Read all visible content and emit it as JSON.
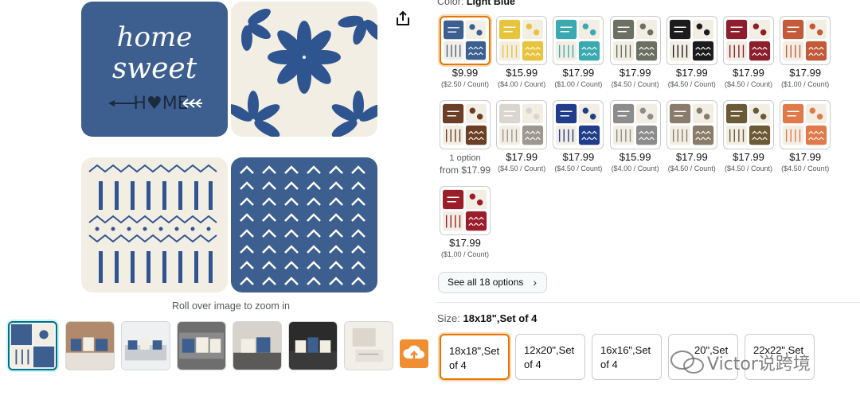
{
  "main_image": {
    "pillow1_text": [
      "home",
      "sweet",
      "H♥ME"
    ],
    "zoom_hint": "Roll over image to zoom in"
  },
  "icons": {
    "share": "share-icon",
    "upload": "upload-icon",
    "chevron": "chevron-right-icon"
  },
  "colors": {
    "navy": "#3d5f8f",
    "cream": "#f3eee4",
    "selected_border": "#e77600",
    "link_teal": "#007185"
  },
  "color_section": {
    "label": "Color:",
    "selected_value": "Light Blue"
  },
  "swatches": [
    {
      "price": "$9.99",
      "unit": "($2.50 / Count)",
      "c1": "#3d5f8f",
      "c2": "#3d5f8f",
      "selected": true
    },
    {
      "price": "$15.99",
      "unit": "($4.00 / Count)",
      "c1": "#e8c43c",
      "c2": "#e8c43c"
    },
    {
      "price": "$17.99",
      "unit": "($1.00 / Count)",
      "c1": "#3aaab0",
      "c2": "#3aaab0"
    },
    {
      "price": "$17.99",
      "unit": "($4.50 / Count)",
      "c1": "#6b7062",
      "c2": "#6b7062"
    },
    {
      "price": "$17.99",
      "unit": "($4.50 / Count)",
      "c1": "#1c1c1c",
      "c2": "#1c1c1c"
    },
    {
      "price": "$17.99",
      "unit": "($4.50 / Count)",
      "c1": "#8c1f2b",
      "c2": "#8c1f2b"
    },
    {
      "price": "$17.99",
      "unit": "($1.00 / Count)",
      "c1": "#c35a3a",
      "c2": "#c35a3a"
    },
    {
      "option": "1 option",
      "from": "from $17.99",
      "c1": "#6b3e26",
      "c2": "#6b3e26"
    },
    {
      "price": "$17.99",
      "unit": "($4.50 / Count)",
      "c1": "#d9d6cf",
      "c2": "#9c9890"
    },
    {
      "price": "$17.99",
      "unit": "($4.50 / Count)",
      "c1": "#1f3d8a",
      "c2": "#1f3d8a"
    },
    {
      "price": "$15.99",
      "unit": "($4.00 / Count)",
      "c1": "#8c8c8c",
      "c2": "#8c8c8c"
    },
    {
      "price": "$17.99",
      "unit": "($4.50 / Count)",
      "c1": "#8a7b6a",
      "c2": "#8a7b6a"
    },
    {
      "price": "$17.99",
      "unit": "($4.50 / Count)",
      "c1": "#6b5a36",
      "c2": "#6b5a36"
    },
    {
      "price": "$17.99",
      "unit": "($4.50 / Count)",
      "c1": "#e07a4a",
      "c2": "#e07a4a"
    },
    {
      "price": "$17.99",
      "unit": "($1.00 / Count)",
      "c1": "#9a1e2a",
      "c2": "#9a1e2a"
    }
  ],
  "see_all": {
    "label": "See all 18 options"
  },
  "size_section": {
    "label": "Size:",
    "selected_value": "18x18\",Set of 4",
    "options": [
      {
        "line1": "18x18\",Set",
        "line2": "of 4",
        "selected": true
      },
      {
        "line1": "12x20\",Set",
        "line2": "of 4"
      },
      {
        "line1": "16x16\",Set",
        "line2": "of 4"
      },
      {
        "line1": "20\",Set",
        "line2": ""
      },
      {
        "line1": "22x22\",Set",
        "line2": ""
      }
    ]
  },
  "watermark": {
    "text": "Victor说跨境"
  }
}
